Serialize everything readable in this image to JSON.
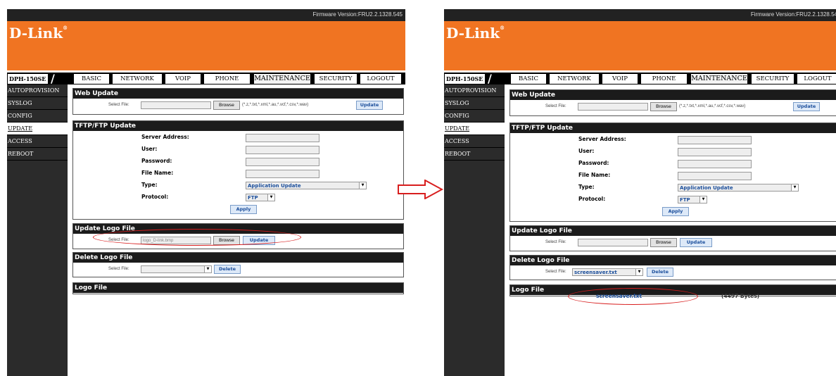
{
  "screens": [
    {
      "firmware_version": "Firmware Version:FRU2.2.1328.545",
      "logo": "D-Link",
      "logo_mark": "®",
      "model": "DPH-150SE",
      "nav": [
        "BASIC",
        "NETWORK",
        "VOIP",
        "PHONE",
        "MAINTENANCE",
        "SECURITY",
        "LOGOUT"
      ],
      "sidebar": [
        "AUTOPROVISION",
        "SYSLOG",
        "CONFIG",
        "UPDATE",
        "ACCESS",
        "REBOOT"
      ],
      "web_update": {
        "title": "Web Update",
        "select_label": "Select File:",
        "browse": "Browse",
        "extensions": "(*.z,*.txt,*.xml,*.au,*.vcf,*.csv,*.wav)",
        "update": "Update"
      },
      "tftp": {
        "title": "TFTP/FTP Update",
        "server": "Server Address:",
        "user": "User:",
        "password": "Password:",
        "filename": "File Name:",
        "type": "Type:",
        "type_value": "Application Update",
        "protocol": "Protocol:",
        "protocol_value": "FTP",
        "apply": "Apply"
      },
      "update_logo": {
        "title": "Update Logo File",
        "select_label": "Select File:",
        "file_value": "logo_D-link.bmp",
        "browse": "Browse",
        "update": "Update"
      },
      "delete_logo": {
        "title": "Delete Logo File",
        "select_label": "Select File:",
        "file_value": "",
        "delete": "Delete"
      },
      "logo_file": {
        "title": "Logo File",
        "name": "",
        "size": ""
      }
    },
    {
      "firmware_version": "Firmware Version:FRU2.2.1328.54",
      "logo": "D-Link",
      "logo_mark": "®",
      "model": "DPH-150SE",
      "nav": [
        "BASIC",
        "NETWORK",
        "VOIP",
        "PHONE",
        "MAINTENANCE",
        "SECURITY",
        "LOGOUT"
      ],
      "sidebar": [
        "AUTOPROVISION",
        "SYSLOG",
        "CONFIG",
        "UPDATE",
        "ACCESS",
        "REBOOT"
      ],
      "web_update": {
        "title": "Web Update",
        "select_label": "Select File:",
        "browse": "Browse",
        "extensions": "(*.z,*.txt,*.xml,*.au,*.vcf,*.csv,*.wav)",
        "update": "Update"
      },
      "tftp": {
        "title": "TFTP/FTP Update",
        "server": "Server Address:",
        "user": "User:",
        "password": "Password:",
        "filename": "File Name:",
        "type": "Type:",
        "type_value": "Application Update",
        "protocol": "Protocol:",
        "protocol_value": "FTP",
        "apply": "Apply"
      },
      "update_logo": {
        "title": "Update Logo File",
        "select_label": "Select File:",
        "file_value": "",
        "browse": "Browse",
        "update": "Update"
      },
      "delete_logo": {
        "title": "Delete Logo File",
        "select_label": "Select File:",
        "file_value": "screensaver.txt",
        "delete": "Delete"
      },
      "logo_file": {
        "title": "Logo File",
        "name": "screensaver.txt",
        "size": "(4497 Bytes)"
      }
    }
  ],
  "colors": {
    "header": "#f07422",
    "highlight": "#d81e1e",
    "link_blue": "#1b4e9b"
  }
}
